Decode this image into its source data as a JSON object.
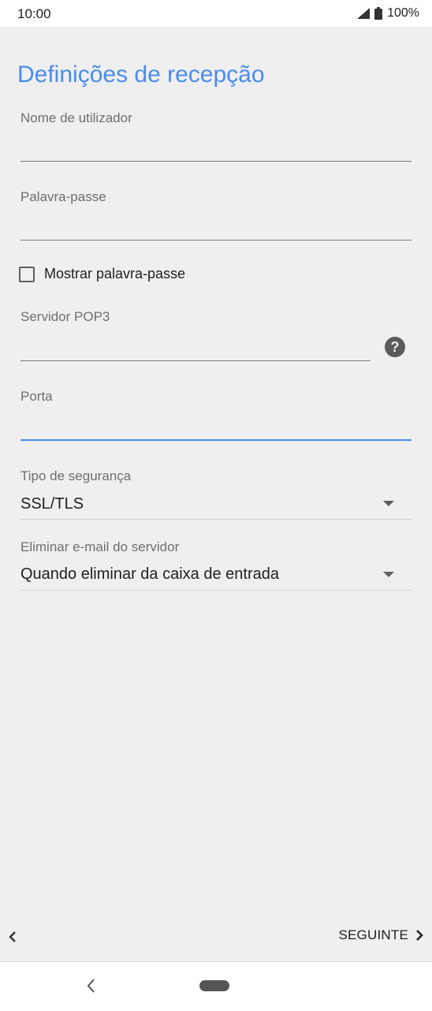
{
  "status_bar": {
    "time": "10:00",
    "battery": "100%"
  },
  "page": {
    "title": "Definições de recepção"
  },
  "form": {
    "username": {
      "label": "Nome de utilizador",
      "value": ""
    },
    "password": {
      "label": "Palavra-passe",
      "value": ""
    },
    "show_password": {
      "label": "Mostrar palavra-passe",
      "checked": false
    },
    "pop3_server": {
      "label": "Servidor POP3",
      "value": ""
    },
    "port": {
      "label": "Porta",
      "value": ""
    },
    "security_type": {
      "label": "Tipo de segurança",
      "value": "SSL/TLS"
    },
    "delete_from_server": {
      "label": "Eliminar e-mail do servidor",
      "value": "Quando eliminar da caixa de entrada"
    }
  },
  "navigation": {
    "next_label": "SEGUINTE"
  },
  "colors": {
    "accent": "#4a8cf0",
    "background": "#efefef"
  },
  "icons": [
    "signal-icon",
    "battery-icon",
    "help-icon",
    "chevron-left-icon",
    "chevron-right-icon",
    "dropdown-arrow-icon",
    "nav-back-icon",
    "nav-home-icon"
  ]
}
